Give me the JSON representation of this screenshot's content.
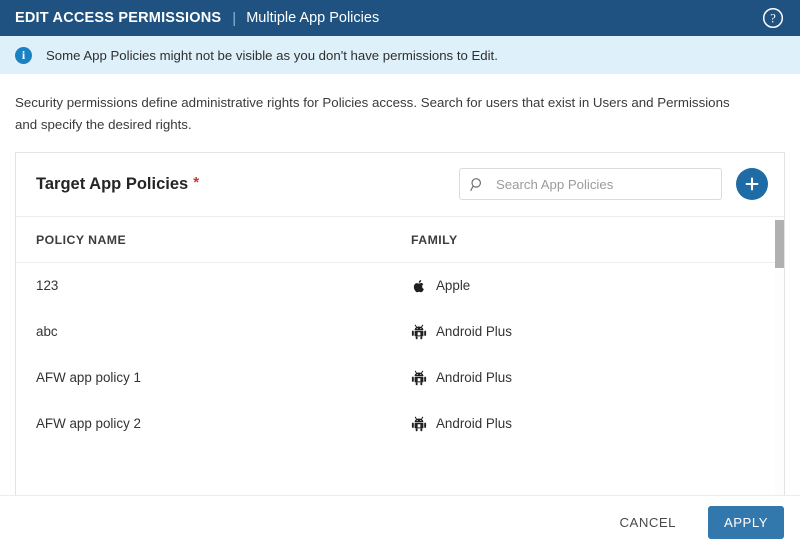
{
  "titlebar": {
    "main_title": "EDIT ACCESS PERMISSIONS",
    "separator": "|",
    "subtitle": "Multiple App Policies",
    "help_icon": "help-circle-icon"
  },
  "banner": {
    "icon": "info-circle-icon",
    "icon_glyph": "i",
    "text": "Some App Policies might not be visible as you don't have permissions to Edit.",
    "background_color": "#def0fa",
    "icon_color": "#1a81c4"
  },
  "description": {
    "text": "Security permissions define administrative rights for Policies access. Search for users that exist in Users and Permissions and specify the desired rights."
  },
  "card": {
    "title": "Target App Policies",
    "required_marker": "*",
    "required_color": "#c9392b",
    "search": {
      "icon": "search-icon",
      "placeholder": "Search App Policies",
      "value": ""
    },
    "add_button": {
      "icon": "plus-icon",
      "color": "#1f6ba5"
    },
    "table": {
      "columns": [
        "POLICY NAME",
        "FAMILY"
      ],
      "rows": [
        {
          "policy_name": "123",
          "family": "Apple",
          "family_icon": "apple-icon"
        },
        {
          "policy_name": "abc",
          "family": "Android Plus",
          "family_icon": "android-icon"
        },
        {
          "policy_name": "AFW app policy 1",
          "family": "Android Plus",
          "family_icon": "android-icon"
        },
        {
          "policy_name": "AFW app policy 2",
          "family": "Android Plus",
          "family_icon": "android-icon"
        }
      ],
      "scrollbar": {
        "visible": true
      }
    }
  },
  "footer": {
    "cancel_label": "CANCEL",
    "apply_label": "APPLY",
    "apply_color": "#3278ad"
  },
  "theme": {
    "header_blue": "#1f5280",
    "accent_blue": "#1f6ba5"
  }
}
